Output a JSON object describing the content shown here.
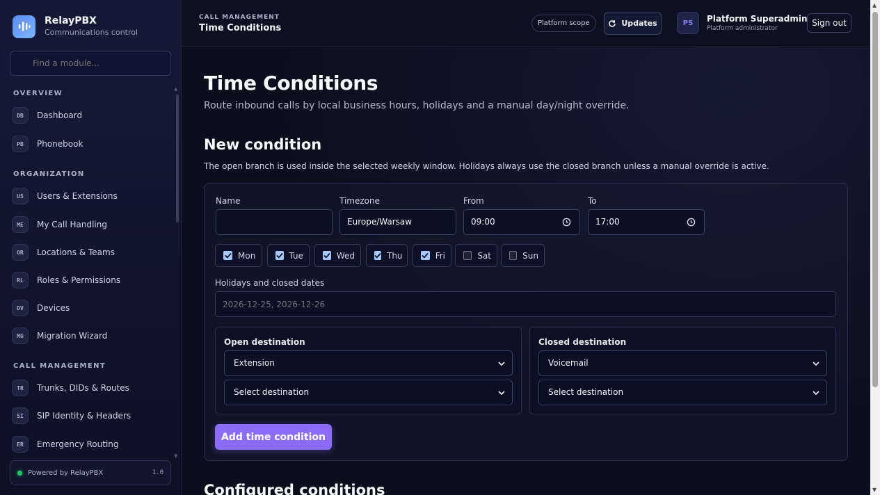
{
  "brand": {
    "name": "RelayPBX",
    "subtitle": "Communications control"
  },
  "search": {
    "placeholder": "Find a module..."
  },
  "nav": {
    "sections": [
      {
        "title": "OVERVIEW",
        "items": [
          {
            "badge": "DB",
            "label": "Dashboard"
          },
          {
            "badge": "PB",
            "label": "Phonebook"
          }
        ]
      },
      {
        "title": "ORGANIZATION",
        "items": [
          {
            "badge": "US",
            "label": "Users & Extensions"
          },
          {
            "badge": "ME",
            "label": "My Call Handling"
          },
          {
            "badge": "OR",
            "label": "Locations & Teams"
          },
          {
            "badge": "RL",
            "label": "Roles & Permissions"
          },
          {
            "badge": "DV",
            "label": "Devices"
          },
          {
            "badge": "MG",
            "label": "Migration Wizard"
          }
        ]
      },
      {
        "title": "CALL MANAGEMENT",
        "items": [
          {
            "badge": "TR",
            "label": "Trunks, DIDs & Routes"
          },
          {
            "badge": "SI",
            "label": "SIP Identity & Headers"
          },
          {
            "badge": "ER",
            "label": "Emergency Routing"
          }
        ]
      }
    ]
  },
  "footer": {
    "text": "Powered by RelayPBX",
    "version": "1.0",
    "status_color": "#22c55e"
  },
  "topbar": {
    "breadcrumb": "CALL MANAGEMENT",
    "title": "Time Conditions",
    "scope": "Platform scope",
    "updates": "Updates",
    "avatar": "PS",
    "user_name": "Platform Superadmin",
    "user_role": "Platform administrator",
    "signout": "Sign out"
  },
  "page": {
    "title": "Time Conditions",
    "subtitle": "Route inbound calls by local business hours, holidays and a manual day/night override.",
    "section_title": "New condition",
    "section_subtitle": "The open branch is used inside the selected weekly window. Holidays always use the closed branch unless a manual override is active.",
    "configured_title": "Configured conditions"
  },
  "form": {
    "name": {
      "label": "Name",
      "value": ""
    },
    "timezone": {
      "label": "Timezone",
      "value": "Europe/Warsaw"
    },
    "from": {
      "label": "From",
      "value": "09:00"
    },
    "to": {
      "label": "To",
      "value": "17:00"
    },
    "days": [
      {
        "label": "Mon",
        "checked": true
      },
      {
        "label": "Tue",
        "checked": true
      },
      {
        "label": "Wed",
        "checked": true
      },
      {
        "label": "Thu",
        "checked": true
      },
      {
        "label": "Fri",
        "checked": true
      },
      {
        "label": "Sat",
        "checked": false
      },
      {
        "label": "Sun",
        "checked": false
      }
    ],
    "holidays": {
      "label": "Holidays and closed dates",
      "placeholder": "2026-12-25, 2026-12-26"
    },
    "open": {
      "title": "Open destination",
      "type": "Extension",
      "target": "Select destination"
    },
    "closed": {
      "title": "Closed destination",
      "type": "Voicemail",
      "target": "Select destination"
    },
    "submit": "Add time condition"
  },
  "colors": {
    "accent": "#8b6cf7",
    "checkbox": "#a8c7fa"
  }
}
